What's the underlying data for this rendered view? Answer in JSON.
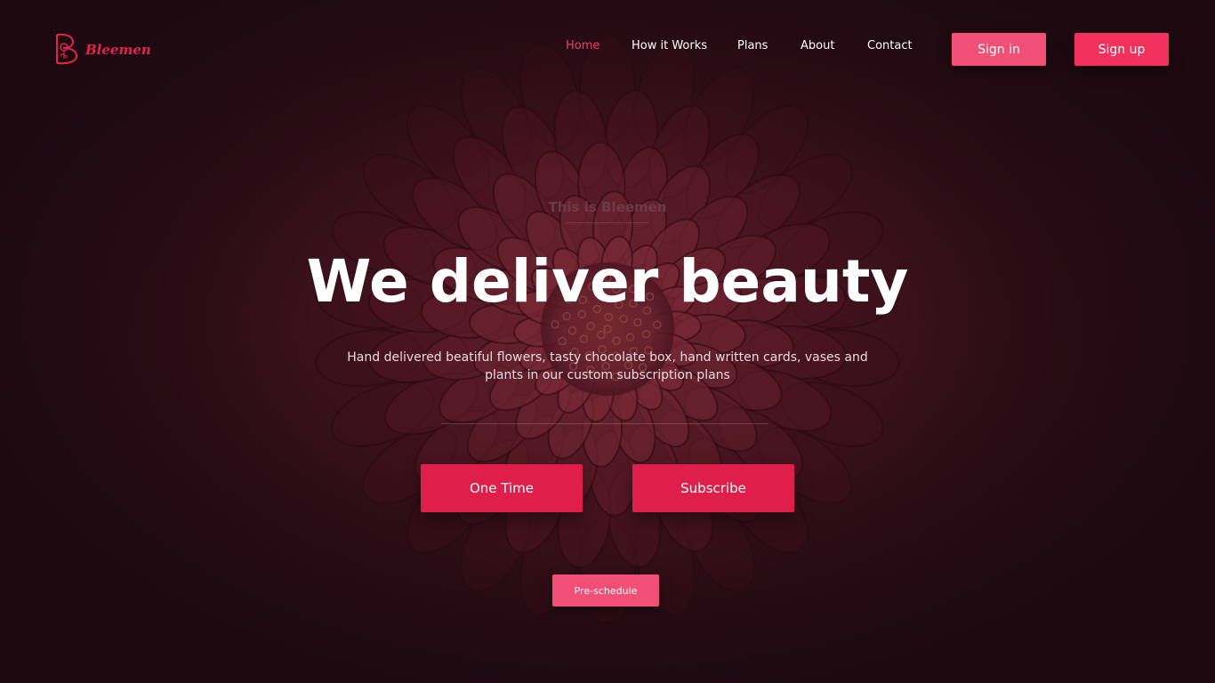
{
  "brand": {
    "name": "Bleemen",
    "logo_icon": "rose-b-logo-icon",
    "accent_color": "#e0254f"
  },
  "nav": {
    "items": [
      {
        "label": "Home",
        "active": true
      },
      {
        "label": "How it Works",
        "active": false
      },
      {
        "label": "Plans",
        "active": false
      },
      {
        "label": "About",
        "active": false
      },
      {
        "label": "Contact",
        "active": false
      }
    ],
    "sign_in": "Sign in",
    "sign_up": "Sign up"
  },
  "hero": {
    "eyebrow": "This is Bleemen",
    "headline": "We deliver beauty",
    "subtitle": "Hand delivered beatiful flowers, tasty chocolate box, hand written cards, vases and plants in our custom subscription plans",
    "buttons": {
      "one_time": "One Time",
      "subscribe": "Subscribe",
      "pre_schedule": "Pre-schedule"
    },
    "background_image": "red-zinnia-flower-closeup"
  },
  "colors": {
    "primary_button": "#df1f49",
    "secondary_button": "#f24f77",
    "active_nav": "#ef3d6a",
    "background": "#1f0c14"
  }
}
